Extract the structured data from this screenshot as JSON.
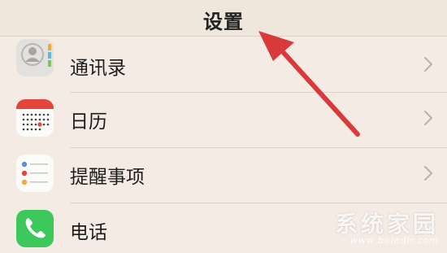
{
  "nav": {
    "title": "设置"
  },
  "rows": [
    {
      "label": "通讯录",
      "icon": "contacts-icon"
    },
    {
      "label": "日历",
      "icon": "calendar-icon"
    },
    {
      "label": "提醒事项",
      "icon": "reminders-icon"
    },
    {
      "label": "电话",
      "icon": "phone-icon"
    }
  ],
  "annotation": {
    "icon": "red-arrow-icon",
    "color": "#d9393a"
  },
  "watermark": {
    "title": "系统家园",
    "url": "www.boledir.com"
  },
  "colors": {
    "background": "#f4ece4",
    "phone_green": "#3cc85a",
    "calendar_red": "#e5463a"
  }
}
